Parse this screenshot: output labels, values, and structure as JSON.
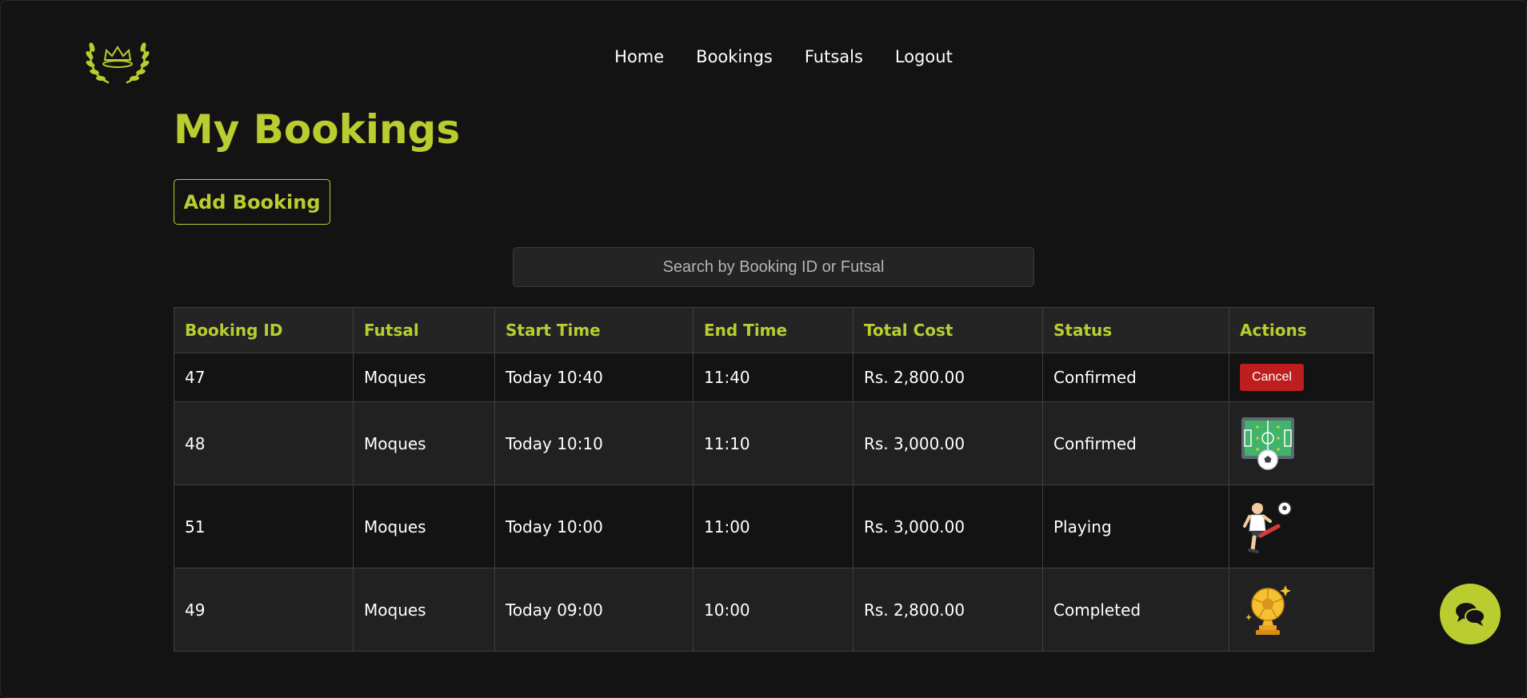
{
  "nav": {
    "items": [
      "Home",
      "Bookings",
      "Futsals",
      "Logout"
    ]
  },
  "page": {
    "title": "My Bookings"
  },
  "actions": {
    "add_booking_label": "Add Booking"
  },
  "search": {
    "placeholder": "Search by Booking ID or Futsal",
    "value": ""
  },
  "table": {
    "headers": [
      "Booking ID",
      "Futsal",
      "Start Time",
      "End Time",
      "Total Cost",
      "Status",
      "Actions"
    ],
    "rows": [
      {
        "id": "47",
        "futsal": "Moques",
        "start": "Today 10:40",
        "end": "11:40",
        "cost": "Rs. 2,800.00",
        "status": "Confirmed",
        "action": "Cancel",
        "action_icon": "cancel-button"
      },
      {
        "id": "48",
        "futsal": "Moques",
        "start": "Today 10:10",
        "end": "11:10",
        "cost": "Rs. 3,000.00",
        "status": "Confirmed",
        "action_icon": "futsal-field-icon"
      },
      {
        "id": "51",
        "futsal": "Moques",
        "start": "Today 10:00",
        "end": "11:00",
        "cost": "Rs. 3,000.00",
        "status": "Playing",
        "action_icon": "player-kicking-icon"
      },
      {
        "id": "49",
        "futsal": "Moques",
        "start": "Today 09:00",
        "end": "10:00",
        "cost": "Rs. 2,800.00",
        "status": "Completed",
        "action_icon": "trophy-ball-icon"
      }
    ]
  },
  "colors": {
    "accent": "#b9cd31",
    "background": "#141313",
    "cancel": "#be1e1e"
  },
  "icons": {
    "logo": "laurel-crown-logo",
    "chat": "chat-bubbles-icon"
  }
}
